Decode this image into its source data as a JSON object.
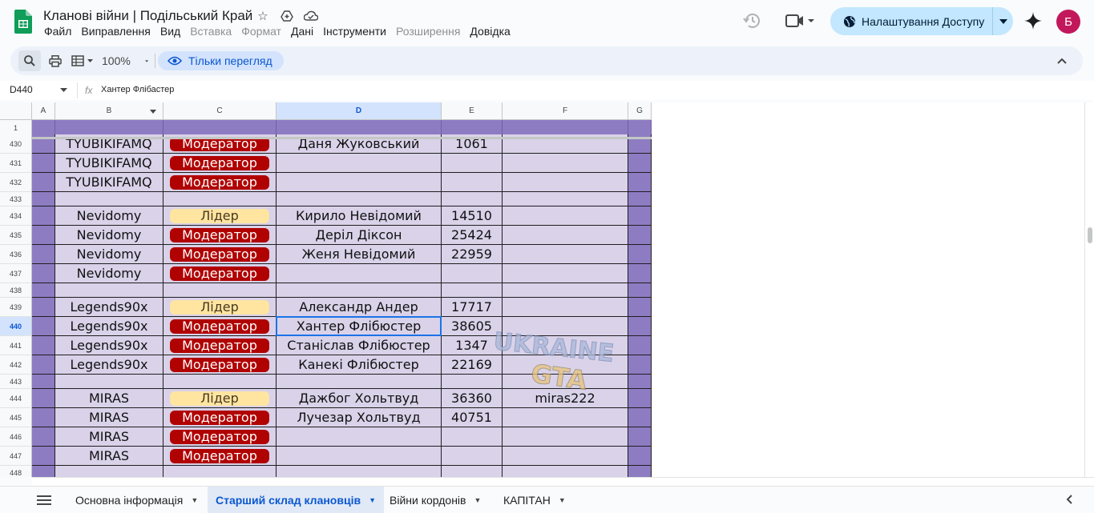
{
  "app": {
    "title": "Кланові війни | Подільський Край",
    "menu": [
      {
        "label": "Файл",
        "disabled": false
      },
      {
        "label": "Виправлення",
        "disabled": false
      },
      {
        "label": "Вид",
        "disabled": false
      },
      {
        "label": "Вставка",
        "disabled": true
      },
      {
        "label": "Формат",
        "disabled": true
      },
      {
        "label": "Дані",
        "disabled": false
      },
      {
        "label": "Інструменти",
        "disabled": false
      },
      {
        "label": "Розширення",
        "disabled": true
      },
      {
        "label": "Довідка",
        "disabled": false
      }
    ],
    "share_label": "Налаштування Доступу",
    "avatar_letter": "Б"
  },
  "toolbar": {
    "zoom": "100%",
    "view_only_label": "Тільки перегляд"
  },
  "formula_bar": {
    "cell_ref": "D440",
    "fx": "fx",
    "content": "Хантер Флібастер"
  },
  "grid": {
    "columns": [
      {
        "id": "A",
        "selected": false
      },
      {
        "id": "B",
        "selected": false,
        "filter": true
      },
      {
        "id": "C",
        "selected": false
      },
      {
        "id": "D",
        "selected": true
      },
      {
        "id": "E",
        "selected": false
      },
      {
        "id": "F",
        "selected": false
      },
      {
        "id": "G",
        "selected": false
      }
    ],
    "header_row_number": "1",
    "rows": [
      {
        "n": "430",
        "clan": "TYUBIKIFAMQ",
        "role": "Модератор",
        "kind": "mod",
        "name": "Даня Жуковський",
        "id": "1061",
        "extra": ""
      },
      {
        "n": "431",
        "clan": "TYUBIKIFAMQ",
        "role": "Модератор",
        "kind": "mod",
        "name": "",
        "id": "",
        "extra": ""
      },
      {
        "n": "432",
        "clan": "TYUBIKIFAMQ",
        "role": "Модератор",
        "kind": "mod",
        "name": "",
        "id": "",
        "extra": ""
      },
      {
        "n": "433",
        "clan": "",
        "role": "",
        "kind": "empty",
        "name": "",
        "id": "",
        "extra": ""
      },
      {
        "n": "434",
        "clan": "Nevidomy",
        "role": "Лідер",
        "kind": "lead",
        "name": "Кирило Невідомий",
        "id": "14510",
        "extra": ""
      },
      {
        "n": "435",
        "clan": "Nevidomy",
        "role": "Модератор",
        "kind": "mod",
        "name": "Деріл Діксон",
        "id": "25424",
        "extra": ""
      },
      {
        "n": "436",
        "clan": "Nevidomy",
        "role": "Модератор",
        "kind": "mod",
        "name": "Женя Невідомий",
        "id": "22959",
        "extra": ""
      },
      {
        "n": "437",
        "clan": "Nevidomy",
        "role": "Модератор",
        "kind": "mod",
        "name": "",
        "id": "",
        "extra": ""
      },
      {
        "n": "438",
        "clan": "",
        "role": "",
        "kind": "empty",
        "name": "",
        "id": "",
        "extra": ""
      },
      {
        "n": "439",
        "clan": "Legends90x",
        "role": "Лідер",
        "kind": "lead",
        "name": "Александр Андер",
        "id": "17717",
        "extra": ""
      },
      {
        "n": "440",
        "clan": "Legends90x",
        "role": "Модератор",
        "kind": "mod",
        "name": "Хантер Флібюстер",
        "id": "38605",
        "extra": "",
        "selected": true
      },
      {
        "n": "441",
        "clan": "Legends90x",
        "role": "Модератор",
        "kind": "mod",
        "name": "Станіслав Флібюстер",
        "id": "1347",
        "extra": ""
      },
      {
        "n": "442",
        "clan": "Legends90x",
        "role": "Модератор",
        "kind": "mod",
        "name": "Канекі Флібюстер",
        "id": "22169",
        "extra": ""
      },
      {
        "n": "443",
        "clan": "",
        "role": "",
        "kind": "empty",
        "name": "",
        "id": "",
        "extra": ""
      },
      {
        "n": "444",
        "clan": "MIRAS",
        "role": "Лідер",
        "kind": "lead",
        "name": "Дажбог Хольтвуд",
        "id": "36360",
        "extra": "miras222"
      },
      {
        "n": "445",
        "clan": "MIRAS",
        "role": "Модератор",
        "kind": "mod",
        "name": "Лучезар Хольтвуд",
        "id": "40751",
        "extra": ""
      },
      {
        "n": "446",
        "clan": "MIRAS",
        "role": "Модератор",
        "kind": "mod",
        "name": "",
        "id": "",
        "extra": ""
      },
      {
        "n": "447",
        "clan": "MIRAS",
        "role": "Модератор",
        "kind": "mod",
        "name": "",
        "id": "",
        "extra": ""
      },
      {
        "n": "448",
        "clan": "",
        "role": "",
        "kind": "empty",
        "name": "",
        "id": "",
        "extra": ""
      }
    ],
    "watermark": {
      "line1": "UKRAINE",
      "line2": "GTA"
    }
  },
  "sheets": [
    {
      "label": "Основна інформація",
      "active": false
    },
    {
      "label": "Старший склад клановців",
      "active": true
    },
    {
      "label": "Війни кордонів",
      "active": false
    },
    {
      "label": "КАПІТАН",
      "active": false
    }
  ],
  "colors": {
    "accent": "#0b57d0",
    "moderator": "#b10202",
    "leader": "#ffe5a0",
    "row_fill": "#d9d2e9",
    "column_fill": "#8e7cc3"
  }
}
